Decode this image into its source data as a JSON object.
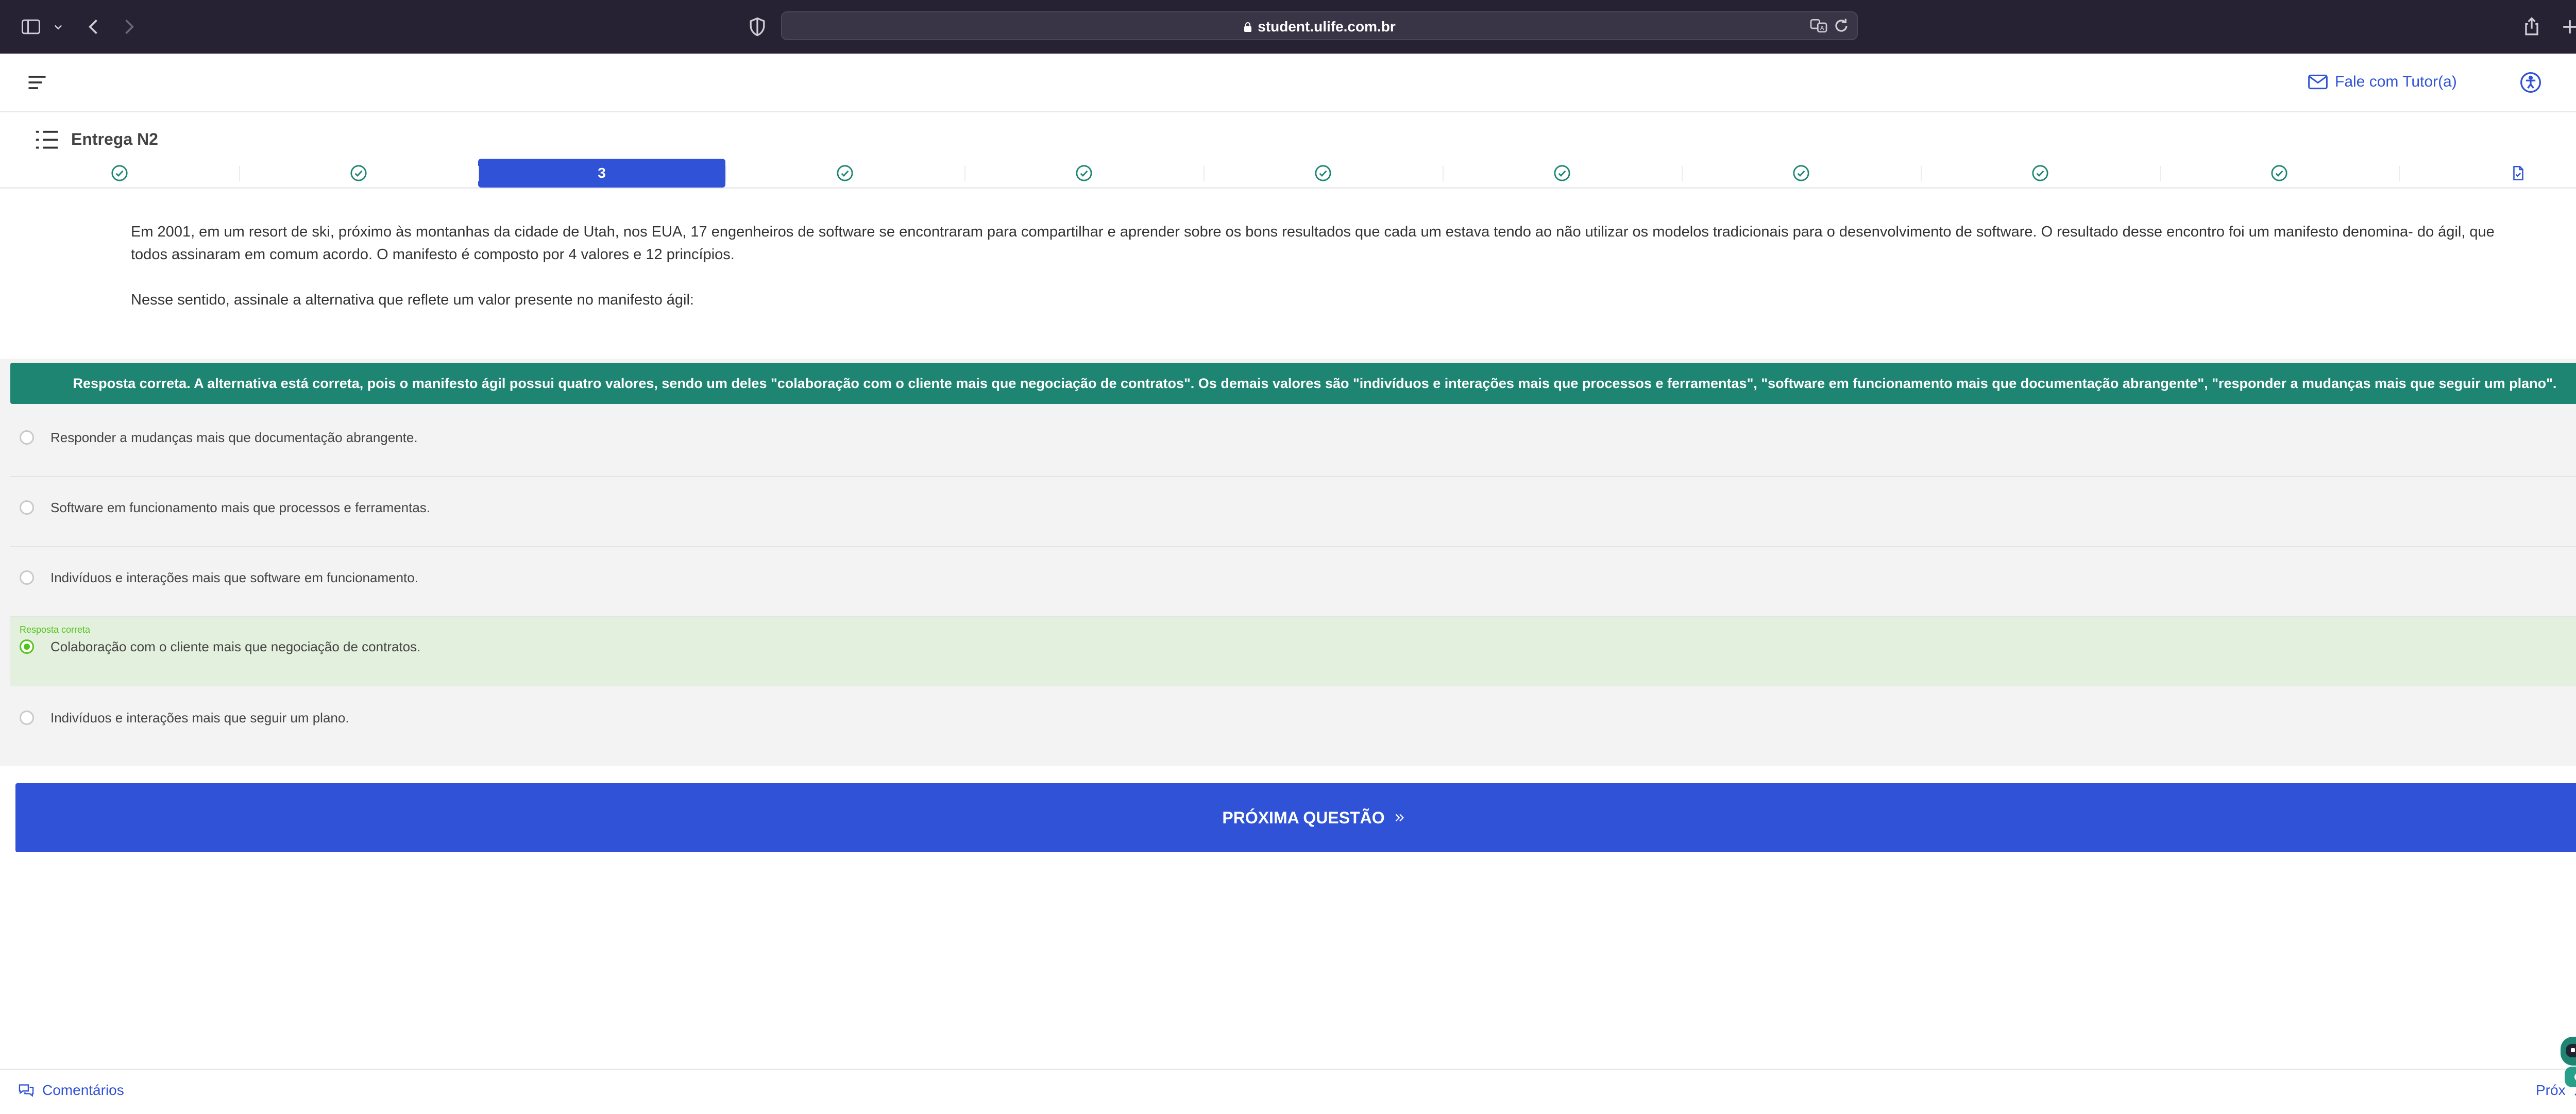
{
  "browser": {
    "url": "student.ulife.com.br",
    "icons": [
      "sidebar-icon",
      "chevron-down-icon",
      "back-icon",
      "forward-icon",
      "shield-icon",
      "translate-icon",
      "reload-icon",
      "share-icon",
      "new-tab-icon",
      "tab-overview-icon"
    ]
  },
  "header": {
    "tutor_label": "Fale com Tutor(a)"
  },
  "page": {
    "title": "Entrega N2"
  },
  "stepper": {
    "active_label": "3",
    "steps": [
      {
        "state": "done"
      },
      {
        "state": "done"
      },
      {
        "state": "active",
        "label": "3"
      },
      {
        "state": "done"
      },
      {
        "state": "done"
      },
      {
        "state": "done"
      },
      {
        "state": "done"
      },
      {
        "state": "done"
      },
      {
        "state": "done"
      },
      {
        "state": "done"
      },
      {
        "state": "document"
      }
    ]
  },
  "question": {
    "paragraph1": "Em 2001, em um resort de ski, próximo às montanhas da cidade de Utah, nos EUA, 17 engenheiros de software se encontraram para compartilhar e aprender sobre os bons resultados que cada um estava tendo ao não utilizar os modelos tradicionais para o desenvolvimento de software. O resultado desse encontro foi um manifesto denomina- do ágil, que todos assinaram em comum acordo. O manifesto é composto por 4 valores e 12 princípios.",
    "paragraph2": "Nesse sentido, assinale a alternativa que reflete um valor presente no manifesto ágil:"
  },
  "feedback": {
    "text": "Resposta correta. A alternativa está correta, pois o manifesto ágil possui quatro valores, sendo um deles \"colaboração com o cliente mais que negociação de contratos\". Os demais valores são \"indivíduos e interações mais que processos e ferramentas\", \"software em funcionamento mais que documentação abrangente\", \"responder a mudanças mais que seguir um plano\"."
  },
  "options": [
    {
      "text": "Responder a mudanças mais que documentação abrangente.",
      "selected": false
    },
    {
      "text": "Software em funcionamento mais que processos e ferramentas.",
      "selected": false
    },
    {
      "text": "Indivíduos e interações mais que software em funcionamento.",
      "selected": false
    },
    {
      "text": "Colaboração com o cliente mais que negociação de contratos.",
      "selected": true,
      "label": "Resposta correta"
    },
    {
      "text": "Indivíduos e interações mais que seguir um plano.",
      "selected": false
    }
  ],
  "next_button": {
    "label": "PRÓXIMA QUESTÃO"
  },
  "footer": {
    "comments_label": "Comentários",
    "next_label": "Próx"
  },
  "colors": {
    "primary": "#2f52d6",
    "feedback": "#1e8573",
    "correct": "#55c31b",
    "correct_bg": "#e3f0de",
    "browser_bar": "#272233"
  }
}
